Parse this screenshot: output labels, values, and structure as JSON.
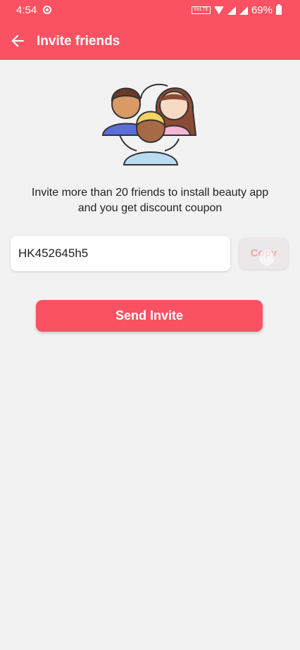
{
  "status_bar": {
    "time": "4:54",
    "network_label": "VoLTE",
    "battery": "69%"
  },
  "header": {
    "title": "Invite friends"
  },
  "main": {
    "message_line1": "Invite more than 20 friends to install beauty app",
    "message_line2": "and you get discount coupon",
    "invite_code": "HK452645h5",
    "copy_label": "Copy",
    "send_label": "Send Invite"
  },
  "colors": {
    "accent": "#fa5262",
    "background": "#f2f2f2"
  },
  "icons": [
    "back-arrow-icon",
    "friends-illustration"
  ]
}
